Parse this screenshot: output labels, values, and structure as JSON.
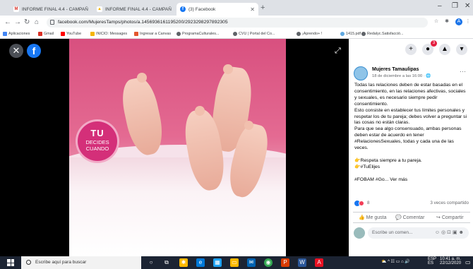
{
  "browser": {
    "tabs": [
      {
        "label": "INFORME FINAL 4.4 - CAMPAÑ",
        "color": "#d93025",
        "icon": "M"
      },
      {
        "label": "INFORME FINAL 4.4 - CAMPAÑ",
        "color": "#f4b400",
        "icon": "▲"
      },
      {
        "label": "(3) Facebook",
        "color": "#1877f2",
        "icon": "f"
      }
    ],
    "new_tab": "+",
    "url": "facebook.com/MujeresTamps/photos/a.1456936161195200/2923298297892305",
    "bookmarks": [
      "Aplicaciones",
      "Gmail",
      "YouTube",
      "INICIO: Messages",
      "Ingresar a Canvas",
      "ProgramaCulturales...",
      "CVU | Portal del Co...",
      "¡Aprendo+ !",
      "1415.pdf",
      "Redalyc.Satisfacció..."
    ],
    "window_controls": {
      "minimize": "–",
      "maximize": "❐",
      "close": "✕"
    }
  },
  "viewer": {
    "close": "✕",
    "fb_logo": "f",
    "expand": "⤢"
  },
  "photo": {
    "badge": {
      "line1": "TU",
      "line2": "DECIDES",
      "line3": "CUANDO"
    },
    "footer_left": "FOBAM",
    "footer_right": "Tam"
  },
  "sidebar": {
    "header_icons": {
      "plus": "+",
      "messenger": "●",
      "bell": "🔔",
      "menu": "▾"
    },
    "notification_count": "3",
    "page_name": "Mujeres Tamaulipas",
    "post_date": "18 de diciembre a las 16:00 · ",
    "more": "···",
    "post_paragraphs": [
      "Todas las relaciones deben de estar basadas en el consentimiento, en las relaciones afectivas, sociales y sexuales, es necesario siempre pedir consentimiento.",
      "Esto consiste en establecer tus límites personales y respetar los de tu pareja; debes volver a preguntar si las cosas no están claras.",
      "Para que sea algo consensuado, ambas personas deben estar de acuerdo en tener #RelacionesSexuales, todas y cada una de las veces."
    ],
    "hashtag_bold": "#RelacionesSexuales",
    "bullet1": "👉Respeta siempre a tu pareja.",
    "bullet2": "👉#TuElijes",
    "closing": "#FOBAM #Go... Ver más",
    "reaction_count": "8",
    "shares": "3 veces compartido",
    "like": "Me gusta",
    "comment": "Comentar",
    "share": "Compartir",
    "comment_placeholder": "Escribe un comen..."
  },
  "taskbar": {
    "search_placeholder": "Escribe aquí para buscar",
    "lang": "ESP",
    "lang2": "ES",
    "time": "10:41 a. m.",
    "date": "22/12/2020"
  }
}
